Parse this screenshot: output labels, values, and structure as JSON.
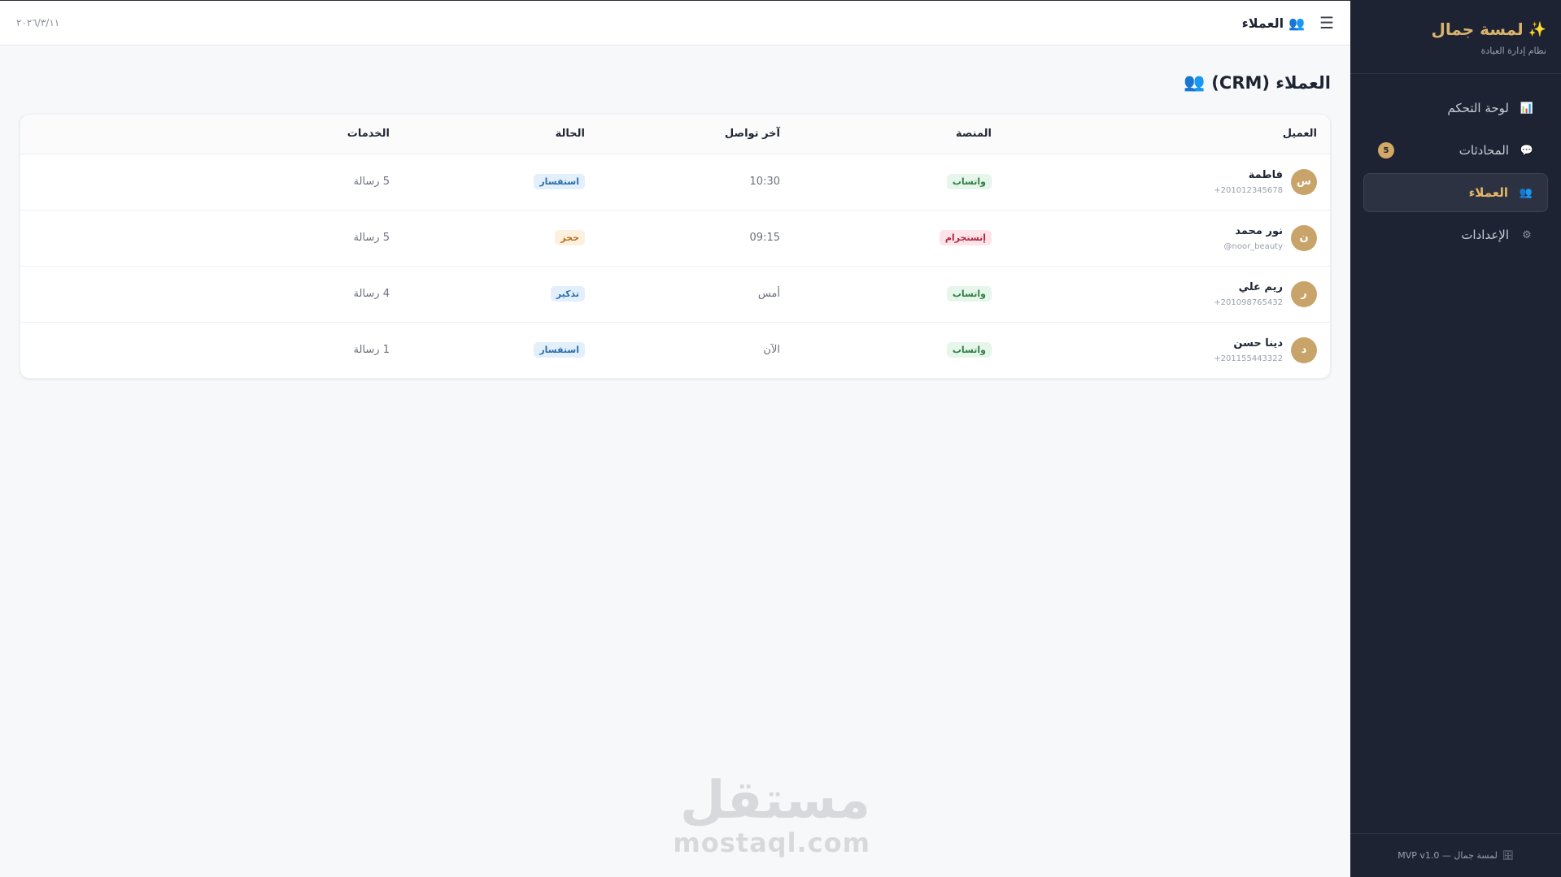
{
  "sidebar": {
    "brand_icon": "✨",
    "brand_title": "لمسة جمال",
    "brand_subtitle": "نظام إدارة العيادة",
    "items": [
      {
        "label": "لوحة التحكم",
        "icon": "chart-icon",
        "glyph": "📊"
      },
      {
        "label": "المحادثات",
        "icon": "chat-icon",
        "glyph": "💬",
        "badge": "5"
      },
      {
        "label": "العملاء",
        "icon": "users-icon",
        "glyph": "👥",
        "active": true
      },
      {
        "label": "الإعدادات",
        "icon": "gear-icon",
        "glyph": "⚙"
      }
    ],
    "footer": "لمسة جمال — MVP v1.0",
    "footer_icon": "🗄"
  },
  "topbar": {
    "menu_glyph": "☰",
    "title_icon": "👥",
    "title": "العملاء",
    "date": "٢٠٢٦/٣/١١"
  },
  "page": {
    "title": "العملاء (CRM)",
    "title_icon": "👥"
  },
  "table": {
    "headers": [
      "العميل",
      "المنصة",
      "آخر تواصل",
      "الحالة",
      "الخدمات"
    ],
    "rows": [
      {
        "initial": "س",
        "name": "فاطمة",
        "contact": "+201012345678",
        "platform": "واتساب",
        "platform_type": "whatsapp",
        "last": "10:30",
        "status": "استفسار",
        "status_type": "inquiry",
        "services": "5 رسالة"
      },
      {
        "initial": "ن",
        "name": "نور محمد",
        "contact": "@noor_beauty",
        "platform": "إنستجرام",
        "platform_type": "instagram",
        "last": "09:15",
        "status": "حجز",
        "status_type": "booking",
        "services": "5 رسالة"
      },
      {
        "initial": "ر",
        "name": "ريم علي",
        "contact": "+201098765432",
        "platform": "واتساب",
        "platform_type": "whatsapp",
        "last": "أمس",
        "status": "تذكير",
        "status_type": "reminder",
        "services": "4 رسالة"
      },
      {
        "initial": "د",
        "name": "دينا حسن",
        "contact": "+201155443322",
        "platform": "واتساب",
        "platform_type": "whatsapp",
        "last": "الآن",
        "status": "استفسار",
        "status_type": "inquiry",
        "services": "1 رسالة"
      }
    ]
  },
  "watermark": {
    "arabic": "مستقل",
    "latin": "mostaql.com"
  },
  "colors": {
    "sidebar_bg": "#1d2333",
    "accent": "#d9b36c",
    "avatar": "#c9a46a"
  }
}
